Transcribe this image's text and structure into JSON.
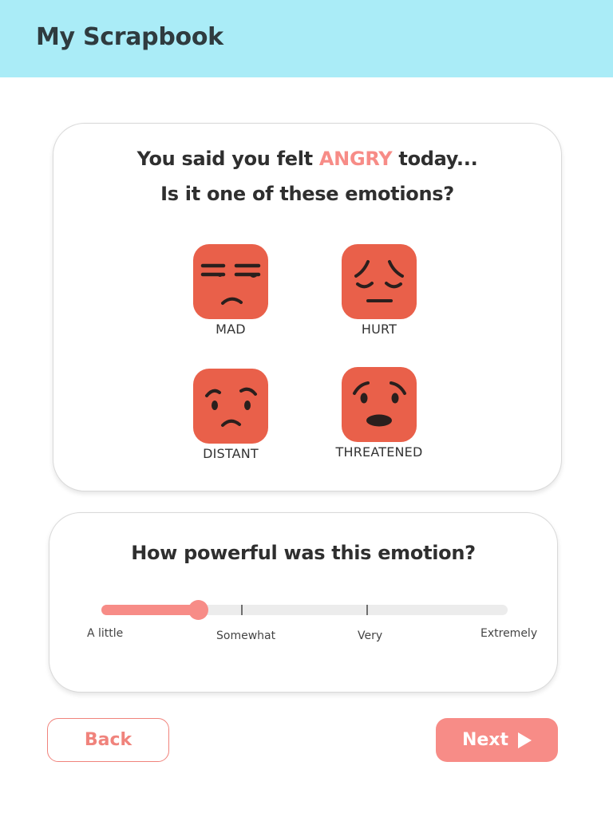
{
  "header": {
    "title": "My Scrapbook"
  },
  "emotions_card": {
    "question_prefix": "You said you felt",
    "feeling": "ANGRY",
    "question_suffix": "today...",
    "question_line2": "Is it one of these emotions?",
    "options": [
      {
        "label": "MAD",
        "icon": "mad-face-icon"
      },
      {
        "label": "HURT",
        "icon": "hurt-face-icon"
      },
      {
        "label": "DISTANT",
        "icon": "distant-face-icon"
      },
      {
        "label": "THREATENED",
        "icon": "threatened-face-icon"
      }
    ]
  },
  "intensity_card": {
    "question": "How powerful was this emotion?",
    "slider": {
      "labels": [
        "A little",
        "Somewhat",
        "Very",
        "Extremely"
      ],
      "value_fraction": 0.237
    }
  },
  "footer": {
    "back_label": "Back",
    "next_label": "Next",
    "next_icon": "play-icon"
  },
  "colors": {
    "header_bg": "#aaecf7",
    "accent": "#f78c87",
    "face": "#e9604a"
  }
}
